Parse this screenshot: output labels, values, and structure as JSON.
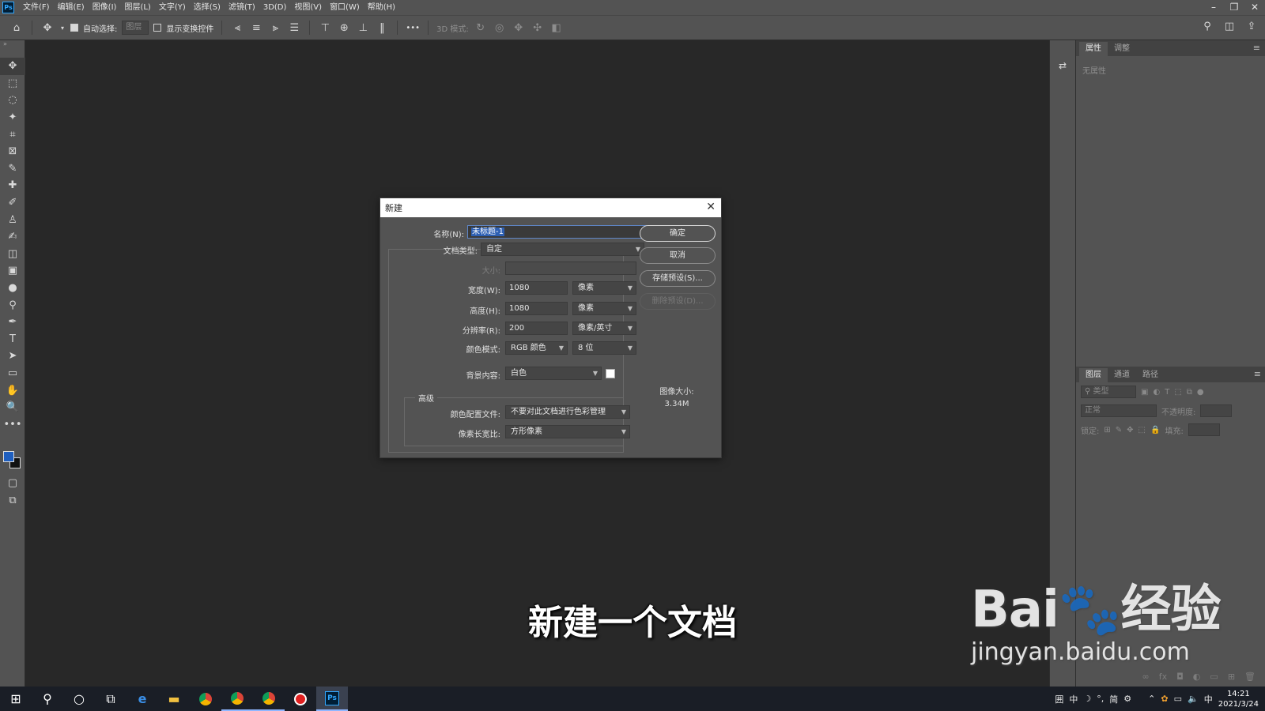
{
  "app": {
    "logo_text": "Ps",
    "menu": [
      "文件(F)",
      "编辑(E)",
      "图像(I)",
      "图层(L)",
      "文字(Y)",
      "选择(S)",
      "滤镜(T)",
      "3D(D)",
      "视图(V)",
      "窗口(W)",
      "帮助(H)"
    ],
    "window_controls": [
      "–",
      "❐",
      "✕"
    ]
  },
  "options_bar": {
    "auto_select_label": "自动选择:",
    "auto_select_value": "图层",
    "show_transform_label": "显示变换控件",
    "mode_3d_label": "3D 模式:",
    "more": "•••"
  },
  "tools": [
    "✥",
    "⬚",
    "◌",
    "✦",
    "⌗",
    "⊠",
    "✎",
    "✚",
    "✐",
    "♙",
    "✍",
    "◫",
    "▣",
    "●",
    "⚲",
    "✒",
    "T",
    "➤",
    "▭",
    "✋",
    "🔍",
    "•••"
  ],
  "panels": {
    "properties_tabs": [
      "属性",
      "调整"
    ],
    "properties_empty": "无属性",
    "layers_tabs": [
      "图层",
      "通道",
      "路径"
    ],
    "layer_search": "类型",
    "blend_mode": "正常",
    "opacity_label": "不透明度:",
    "lock_label": "锁定:",
    "fill_label": "填充:"
  },
  "dialog": {
    "title": "新建",
    "name_label": "名称(N):",
    "name_value": "未标题-1",
    "doc_type_label": "文档类型:",
    "doc_type_value": "自定",
    "size_label": "大小:",
    "width_label": "宽度(W):",
    "width_value": "1080",
    "width_unit": "像素",
    "height_label": "高度(H):",
    "height_value": "1080",
    "height_unit": "像素",
    "resolution_label": "分辨率(R):",
    "resolution_value": "200",
    "resolution_unit": "像素/英寸",
    "color_mode_label": "颜色模式:",
    "color_mode_value": "RGB 颜色",
    "bit_depth": "8 位",
    "background_label": "背景内容:",
    "background_value": "白色",
    "advanced_label": "高级",
    "color_profile_label": "颜色配置文件:",
    "color_profile_value": "不要对此文档进行色彩管理",
    "pixel_aspect_label": "像素长宽比:",
    "pixel_aspect_value": "方形像素",
    "ok": "确定",
    "cancel": "取消",
    "save_preset": "存储预设(S)...",
    "delete_preset": "删除预设(D)...",
    "image_size_label": "图像大小:",
    "image_size_value": "3.34M"
  },
  "subtitle": "新建一个文档",
  "watermark": {
    "main": "Bai🐾经验",
    "sub": "jingyan.baidu.com"
  },
  "taskbar": {
    "ime_chars": [
      "囲",
      "中",
      "☽",
      "°,",
      "简",
      "⚙"
    ],
    "lang": "中",
    "time": "14:21",
    "date": "2021/3/24"
  },
  "colors": {
    "foreground": "#1f5fbf",
    "background": "#111111",
    "accent": "#31a8ff"
  }
}
